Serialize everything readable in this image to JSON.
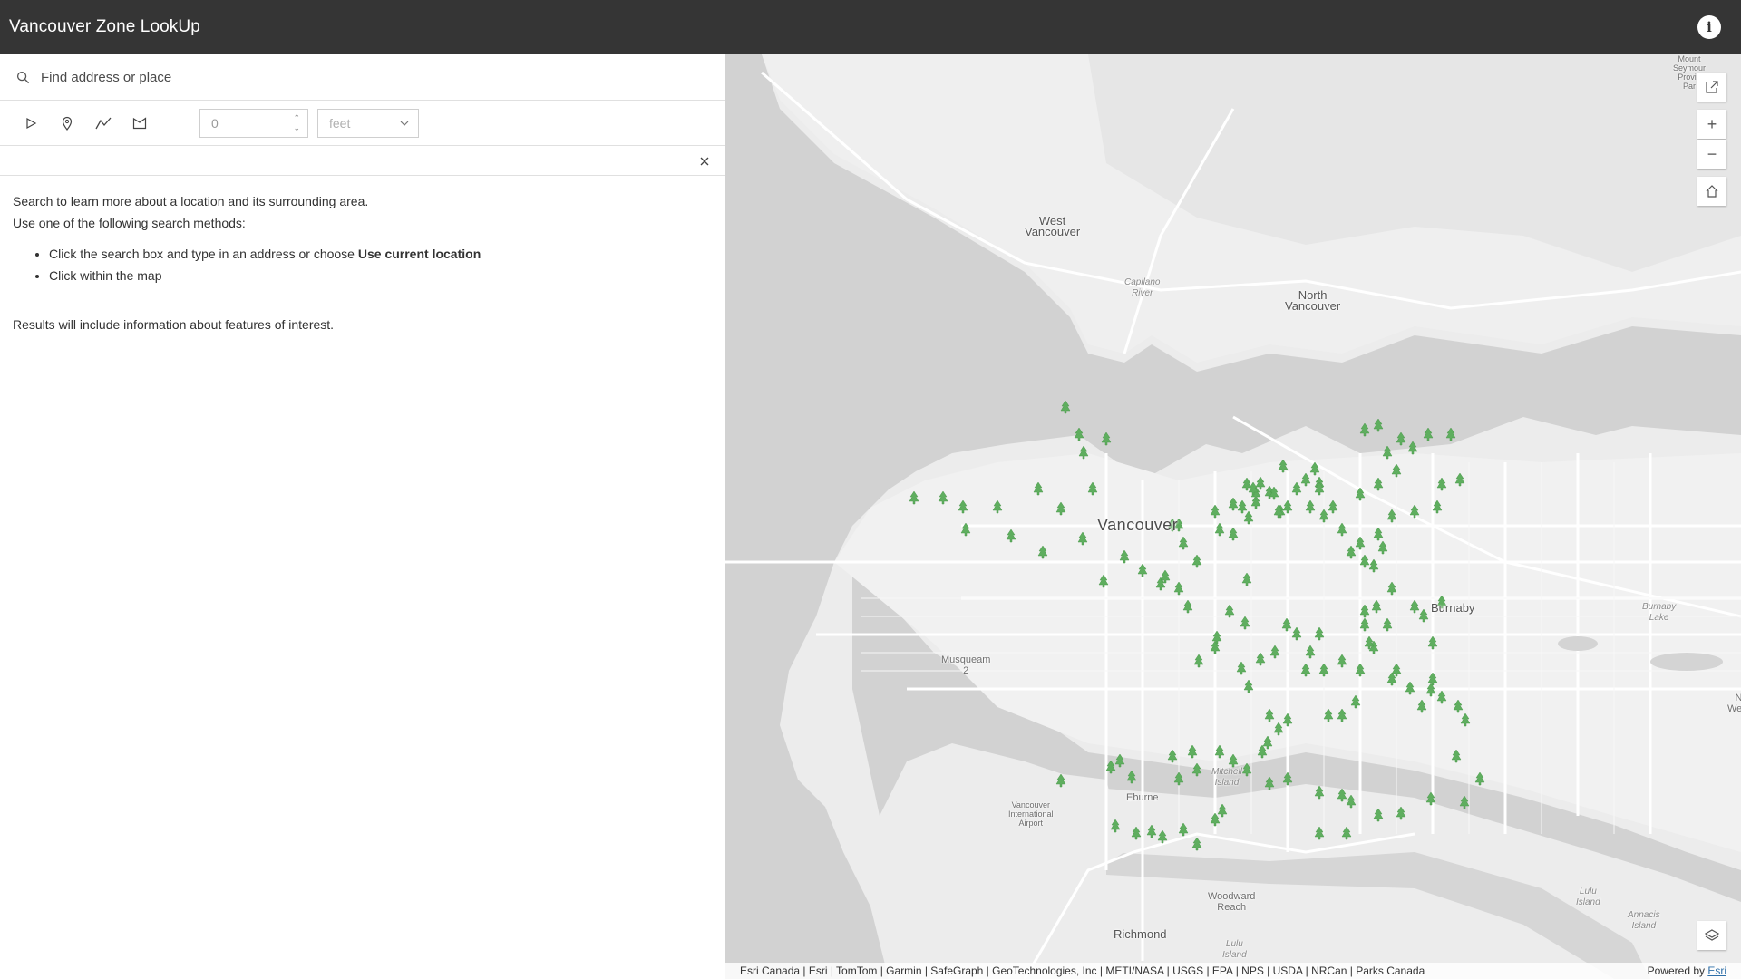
{
  "header": {
    "title": "Vancouver Zone LookUp",
    "info_icon": "info-icon"
  },
  "search": {
    "placeholder": "Find address or place",
    "icon": "search-icon"
  },
  "tools": {
    "items": [
      {
        "icon": "select-arrow-icon"
      },
      {
        "icon": "point-pin-icon"
      },
      {
        "icon": "polyline-icon"
      },
      {
        "icon": "polygon-icon"
      }
    ],
    "buffer_value": "0",
    "unit": "feet"
  },
  "panel": {
    "close_icon": "close-icon",
    "intro": "Search to learn more about a location and its surrounding area.",
    "methods_heading": "Use one of the following search methods:",
    "method_1_prefix": "Click the search box and type in an address or choose ",
    "method_1_bold": "Use current location",
    "method_2": "Click within the map",
    "results_note": "Results will include information about features of interest."
  },
  "map": {
    "labels": {
      "west_vancouver_1": "West",
      "west_vancouver_2": "Vancouver",
      "north_vancouver_1": "North",
      "north_vancouver_2": "Vancouver",
      "capilano_1": "Capilano",
      "capilano_2": "River",
      "vancouver": "Vancouver",
      "burnaby": "Burnaby",
      "burnaby_lake_1": "Burnaby",
      "burnaby_lake_2": "Lake",
      "musqueam_1": "Musqueam",
      "musqueam_2": "2",
      "mitchell_1": "Mitchell",
      "mitchell_2": "Island",
      "airport_1": "Vancouver",
      "airport_2": "International",
      "airport_3": "Airport",
      "eburne": "Eburne",
      "woodward_1": "Woodward",
      "woodward_2": "Reach",
      "richmond": "Richmond",
      "lulu_1": "Lulu",
      "lulu_2": "Island",
      "lulu_lower_1": "Lulu",
      "lulu_lower_2": "Island",
      "annacis_1": "Annacis",
      "annacis_2": "Island",
      "seymour_1": "Mount",
      "seymour_2": "Seymour",
      "seymour_3": "Provin",
      "seymour_4": "Par",
      "west_edge_1": "N",
      "west_edge_2": "West"
    },
    "controls": {
      "share_icon": "share-icon",
      "zoom_in": "+",
      "zoom_out": "−",
      "home_icon": "home-icon",
      "layers_icon": "layers-icon"
    },
    "feature_icon": "tree-icon",
    "feature_color": "#5fae5f",
    "attribution": "Esri Canada | Esri | TomTom | Garmin | SafeGraph | GeoTechnologies, Inc | METI/NASA | USGS | EPA | NPS | USDA | NRCan | Parks Canada",
    "powered_by": "Powered by ",
    "powered_link": "Esri"
  }
}
